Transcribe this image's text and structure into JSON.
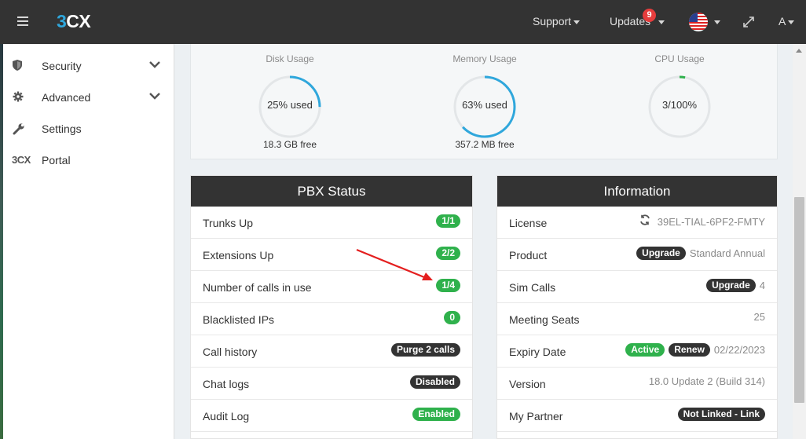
{
  "topbar": {
    "logo_num": "3",
    "logo_cx": "CX",
    "support": "Support",
    "updates": "Updates",
    "updates_count": "9",
    "user": "A"
  },
  "sidebar": {
    "items": [
      {
        "label": "Security",
        "icon": "shield-icon"
      },
      {
        "label": "Advanced",
        "icon": "gear-icon"
      },
      {
        "label": "Settings",
        "icon": "wrench-icon"
      },
      {
        "label": "Portal",
        "icon_text": "3CX"
      }
    ]
  },
  "usage": {
    "disk": {
      "title": "Disk Usage",
      "value": "25% used",
      "sub": "18.3 GB free",
      "percent": 25
    },
    "memory": {
      "title": "Memory Usage",
      "value": "63% used",
      "sub": "357.2 MB free",
      "percent": 63
    },
    "cpu": {
      "title": "CPU Usage",
      "value": "3/100%",
      "sub": "",
      "percent": 3
    }
  },
  "pbx_status": {
    "title": "PBX Status",
    "rows": [
      {
        "label": "Trunks Up",
        "value": "1/1"
      },
      {
        "label": "Extensions Up",
        "value": "2/2"
      },
      {
        "label": "Number of calls in use",
        "value": "1/4"
      },
      {
        "label": "Blacklisted IPs",
        "value": "0"
      },
      {
        "label": "Call history",
        "value": "Purge 2 calls"
      },
      {
        "label": "Chat logs",
        "value": "Disabled"
      },
      {
        "label": "Audit Log",
        "value": "Enabled"
      }
    ]
  },
  "information": {
    "title": "Information",
    "license_label": "License",
    "license_key": "39EL-TIAL-6PF2-FMTY",
    "product_label": "Product",
    "product_upgrade": "Upgrade",
    "product_value": "Standard Annual",
    "simcalls_label": "Sim Calls",
    "simcalls_upgrade": "Upgrade",
    "simcalls_value": "4",
    "meeting_label": "Meeting Seats",
    "meeting_value": "25",
    "expiry_label": "Expiry Date",
    "expiry_active": "Active",
    "expiry_renew": "Renew",
    "expiry_value": "02/22/2023",
    "version_label": "Version",
    "version_value": "18.0 Update 2 (Build 314)",
    "partner_label": "My Partner",
    "partner_value": "Not Linked - Link"
  },
  "colors": {
    "accent": "#2fa7dc",
    "status_green": "#2fb14c",
    "header_dark": "#333333",
    "badge_red": "#e63d3d",
    "annotation_red": "#e41e1e"
  }
}
